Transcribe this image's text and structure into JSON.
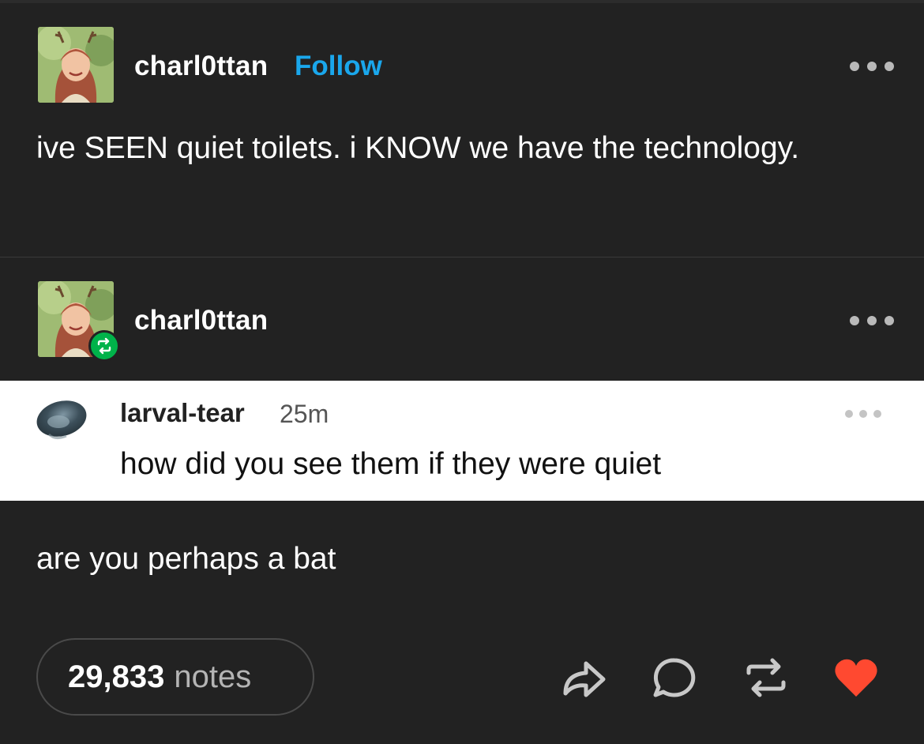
{
  "original_post": {
    "username": "charl0ttan",
    "follow_label": "Follow",
    "text": "ive SEEN quiet toilets. i KNOW we have the technology."
  },
  "reblog_post": {
    "username": "charl0ttan",
    "quoted": {
      "username": "larval-tear",
      "time": "25m",
      "text": "how did you see them if they were quiet"
    },
    "reply_text": "are you perhaps a bat"
  },
  "footer": {
    "notes_count": "29,833",
    "notes_label": "notes",
    "icons": [
      "share-icon",
      "reply-icon",
      "reblog-icon",
      "like-icon"
    ]
  },
  "colors": {
    "background": "#222222",
    "follow": "#1aa7ec",
    "reblog_badge": "#00b34a",
    "like": "#ff4930"
  }
}
